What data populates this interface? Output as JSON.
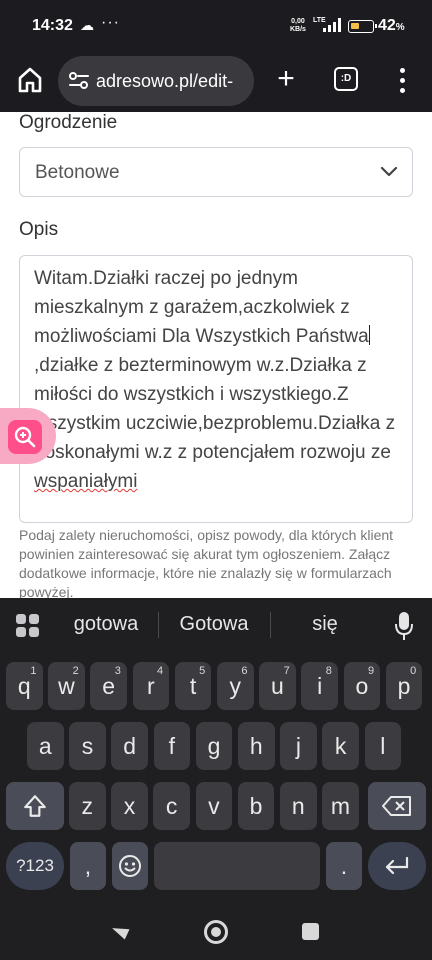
{
  "status": {
    "time": "14:32",
    "net_speed_value": "0,00",
    "net_speed_unit": "KB/s",
    "network": "LTE",
    "battery_pct": "42",
    "battery_unit": "%",
    "battery_level": 0.42
  },
  "browser": {
    "url": "adresowo.pl/edit-",
    "tabs_label": ":D",
    "icons": {
      "home": "home-icon",
      "site_settings": "site-settings-icon",
      "new_tab": "plus-icon",
      "tabs": "tab-switcher-icon",
      "menu": "more-vert-icon"
    }
  },
  "form": {
    "fence_label": "Ogrodzenie",
    "fence_value": "Betonowe",
    "description_label": "Opis",
    "description_text_before_caret": "Witam.Działki raczej po jednym mieszkalnym z garażem,aczkolwiek z możliwościami Dla Wszystkich Państwa",
    "description_text_after_caret": ",działke z bezterminowym w.z.Działka z miłości do wszystkich i wszystkiego.Z wszystkim uczciwie,bezproblemu.Działka z doskonałymi w.z z potencjałem rozwoju ze ",
    "description_text_misspelled": "wspaniałymi",
    "help_text": "Podaj zalety nieruchomości, opisz powody, dla których klient powinien zainteresować się akurat tym ogłoszeniem. Załącz dodatkowe informacje, które nie znalazły się w formularzach powyżej."
  },
  "keyboard": {
    "suggestions": [
      "gotowa",
      "Gotowa",
      "się"
    ],
    "row1": [
      {
        "key": "q",
        "hint": "1"
      },
      {
        "key": "w",
        "hint": "2"
      },
      {
        "key": "e",
        "hint": "3"
      },
      {
        "key": "r",
        "hint": "4"
      },
      {
        "key": "t",
        "hint": "5"
      },
      {
        "key": "y",
        "hint": "6"
      },
      {
        "key": "u",
        "hint": "7"
      },
      {
        "key": "i",
        "hint": "8"
      },
      {
        "key": "o",
        "hint": "9"
      },
      {
        "key": "p",
        "hint": "0"
      }
    ],
    "row2": [
      "a",
      "s",
      "d",
      "f",
      "g",
      "h",
      "j",
      "k",
      "l"
    ],
    "row3": [
      "z",
      "x",
      "c",
      "v",
      "b",
      "n",
      "m"
    ],
    "symbols_label": "?123",
    "comma": ",",
    "period": ".",
    "icons": {
      "apps": "keyboard-apps-icon",
      "mic": "mic-icon",
      "shift": "shift-icon",
      "backspace": "backspace-icon",
      "emoji": "emoji-icon",
      "enter": "enter-icon"
    }
  },
  "navbar": {
    "icons": [
      "back-icon",
      "home-icon",
      "recents-icon"
    ]
  },
  "colors": {
    "status_bg": "#1c1b1f",
    "keyboard_bg": "#1f1f22",
    "key_bg": "#3c3c40",
    "zoom_accent": "#ff4f8b",
    "spell_error": "#e53935"
  }
}
